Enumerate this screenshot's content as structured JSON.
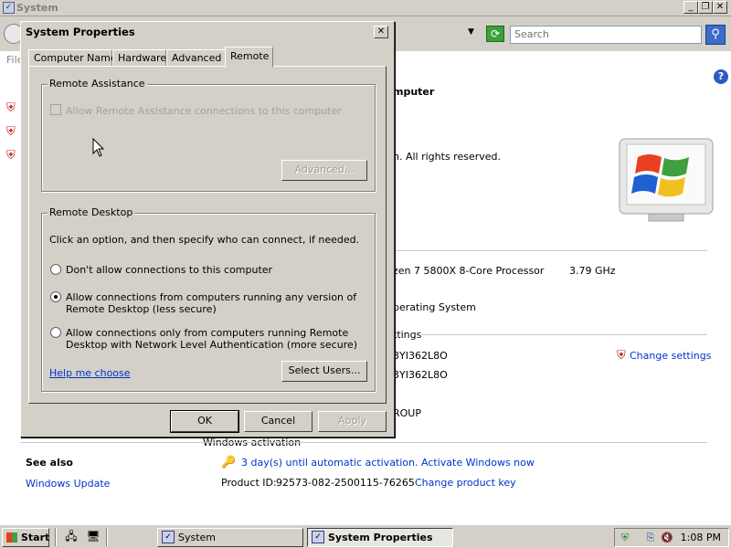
{
  "background_window": {
    "title": "System",
    "menu_file": "File",
    "search_placeholder": "Search",
    "heading_fragment": "mputer",
    "copyright_fragment": "n.  All rights reserved.",
    "processor_fragment": "zen 7 5800X 8-Core Processor",
    "processor_speed": "3.79 GHz",
    "os_fragment": "perating System",
    "settings_fragment": "ttings",
    "computer_name_fragment": "3YI362L8O",
    "full_name_fragment": "3YI362L8O",
    "workgroup_fragment": "ROUP",
    "change_settings": "Change settings",
    "windows_activation": "Windows activation",
    "see_also": "See also",
    "windows_update": "Windows Update",
    "activation_notice": "3 day(s) until automatic activation. Activate Windows now",
    "product_id_label": "Product ID:",
    "product_id": "92573-082-2500115-76265",
    "change_product_key": "Change product key"
  },
  "dialog": {
    "title": "System Properties",
    "close_glyph": "✕",
    "tabs": [
      {
        "label": "Computer Name"
      },
      {
        "label": "Hardware"
      },
      {
        "label": "Advanced"
      },
      {
        "label": "Remote"
      }
    ],
    "active_tab": "Remote",
    "remote_assistance": {
      "label": "Remote Assistance",
      "checkbox_label": "Allow Remote Assistance connections to this computer",
      "checked": false,
      "enabled": false,
      "advanced_button": "Advanced..."
    },
    "remote_desktop": {
      "label": "Remote Desktop",
      "instructions": "Click an option, and then specify who can connect, if needed.",
      "options": [
        {
          "label": "Don't allow connections to this computer",
          "selected": false
        },
        {
          "label": "Allow connections from computers running any version of Remote Desktop (less secure)",
          "line1": "Allow connections from computers running any version of",
          "line2": "Remote Desktop (less secure)",
          "selected": true
        },
        {
          "label": "Allow connections only from computers running Remote Desktop with Network Level Authentication (more secure)",
          "line1": "Allow connections only from computers running Remote",
          "line2": "Desktop with Network Level Authentication (more secure)",
          "selected": false
        }
      ],
      "help_link": "Help me choose",
      "select_users_button": "Select Users..."
    },
    "buttons": {
      "ok": "OK",
      "cancel": "Cancel",
      "apply": "Apply"
    }
  },
  "taskbar": {
    "start": "Start",
    "tasks": [
      {
        "label": "System",
        "active": false
      },
      {
        "label": "System Properties",
        "active": true
      }
    ],
    "clock": "1:08 PM"
  },
  "colors": {
    "window_face": "#d4d0c8",
    "link": "#0033cc"
  }
}
